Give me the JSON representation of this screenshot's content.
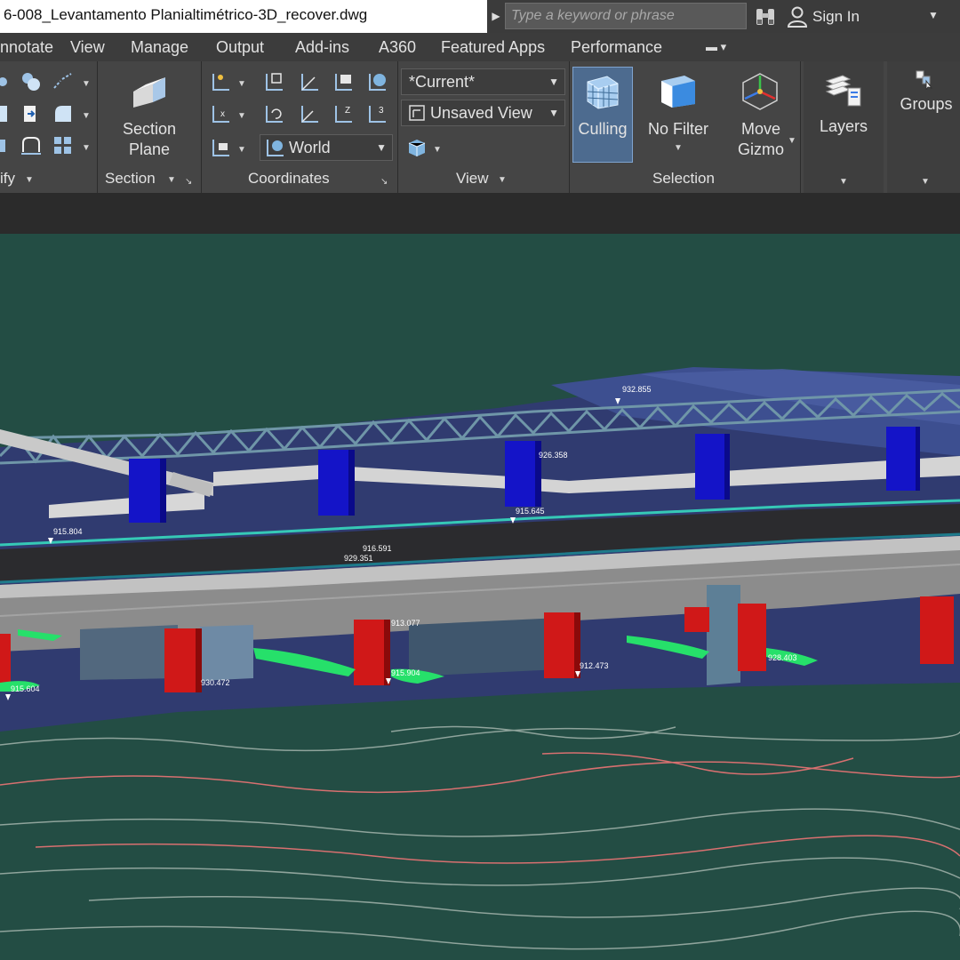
{
  "window": {
    "title": "6-008_Levantamento Planialtimétrico-3D_recover.dwg",
    "search_placeholder": "Type a keyword or phrase",
    "sign_in_label": "Sign In"
  },
  "tabs": [
    "nnotate",
    "View",
    "Manage",
    "Output",
    "Add-ins",
    "A360",
    "Featured Apps",
    "Performance"
  ],
  "ribbon": {
    "modify_label": "ify",
    "section": {
      "button_label_1": "Section",
      "button_label_2": "Plane",
      "panel_label": "Section"
    },
    "coordinates": {
      "ucs_dropdown": "World",
      "panel_label": "Coordinates"
    },
    "view": {
      "visual_style": "*Current*",
      "named_view": "Unsaved View",
      "panel_label": "View"
    },
    "selection": {
      "culling_label": "Culling",
      "filter_label_1": "No Filter",
      "gizmo_label_1": "Move",
      "gizmo_label_2": "Gizmo",
      "panel_label": "Selection"
    },
    "layers_label": "Layers",
    "groups_label": "Groups"
  },
  "colors": {
    "viewport_bg": "#234d44",
    "ribbon_bg": "#454545",
    "pier_blue": "#1414c8",
    "pier_red": "#d01818",
    "truss": "#6f96a8",
    "contour_red": "#d87070",
    "contour_gray": "#8fa49c"
  },
  "drawing_labels": [
    "932.855",
    "915.645",
    "926.358",
    "915.804",
    "916.591",
    "929.351",
    "913.077",
    "930.472",
    "915.904",
    "912.473",
    "928.403",
    "915.604"
  ]
}
